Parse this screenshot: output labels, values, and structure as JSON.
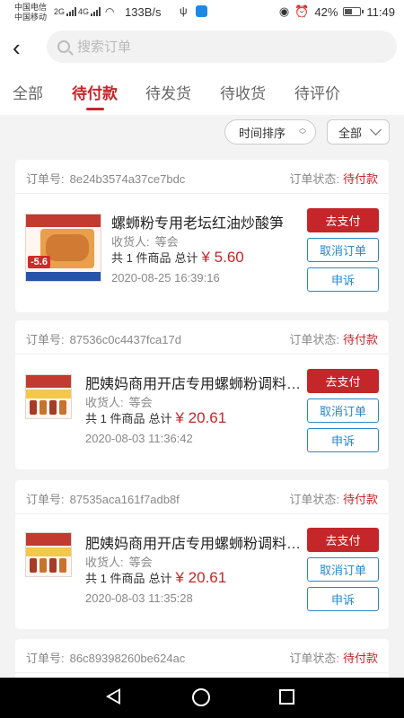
{
  "status_bar": {
    "carrier1": "中国电信",
    "carrier2": "中国移动",
    "net1": "2G",
    "net2": "4G",
    "speed": "133B/s",
    "battery": "42%",
    "time": "11:49"
  },
  "search": {
    "placeholder": "搜索订单"
  },
  "tabs": [
    {
      "label": "全部",
      "active": false
    },
    {
      "label": "待付款",
      "active": true
    },
    {
      "label": "待发货",
      "active": false
    },
    {
      "label": "待收货",
      "active": false
    },
    {
      "label": "待评价",
      "active": false
    }
  ],
  "filters": {
    "sort_label": "时间排序",
    "scope_label": "全部"
  },
  "labels": {
    "order_no": "订单号:",
    "order_status": "订单状态:",
    "receiver": "收货人:",
    "total": "总计",
    "pay": "去支付",
    "cancel": "取消订单",
    "complain": "申诉"
  },
  "orders": [
    {
      "order_no": "8e24b3574a37ce7bdc",
      "status": "待付款",
      "title": "螺蛳粉专用老坛红油炒酸笋",
      "receiver": "等会",
      "count_text": "共 1 件商品",
      "price": "¥ 5.60",
      "time": "2020-08-25 16:39:16",
      "thumb_price": "-5.6"
    },
    {
      "order_no": "87536c0c4437fca17d",
      "status": "待付款",
      "title": "肥姨妈商用开店专用螺蛳粉调料…",
      "receiver": "等会",
      "count_text": "共 1 件商品",
      "price": "¥ 20.61",
      "time": "2020-08-03 11:36:42"
    },
    {
      "order_no": "87535aca161f7adb8f",
      "status": "待付款",
      "title": "肥姨妈商用开店专用螺蛳粉调料…",
      "receiver": "等会",
      "count_text": "共 1 件商品",
      "price": "¥ 20.61",
      "time": "2020-08-03 11:35:28"
    },
    {
      "order_no": "86c89398260be624ac",
      "status": "待付款"
    }
  ],
  "colors": {
    "accent": "#c4262a",
    "link_blue": "#2a87c9",
    "bg": "#f3f3f3"
  }
}
